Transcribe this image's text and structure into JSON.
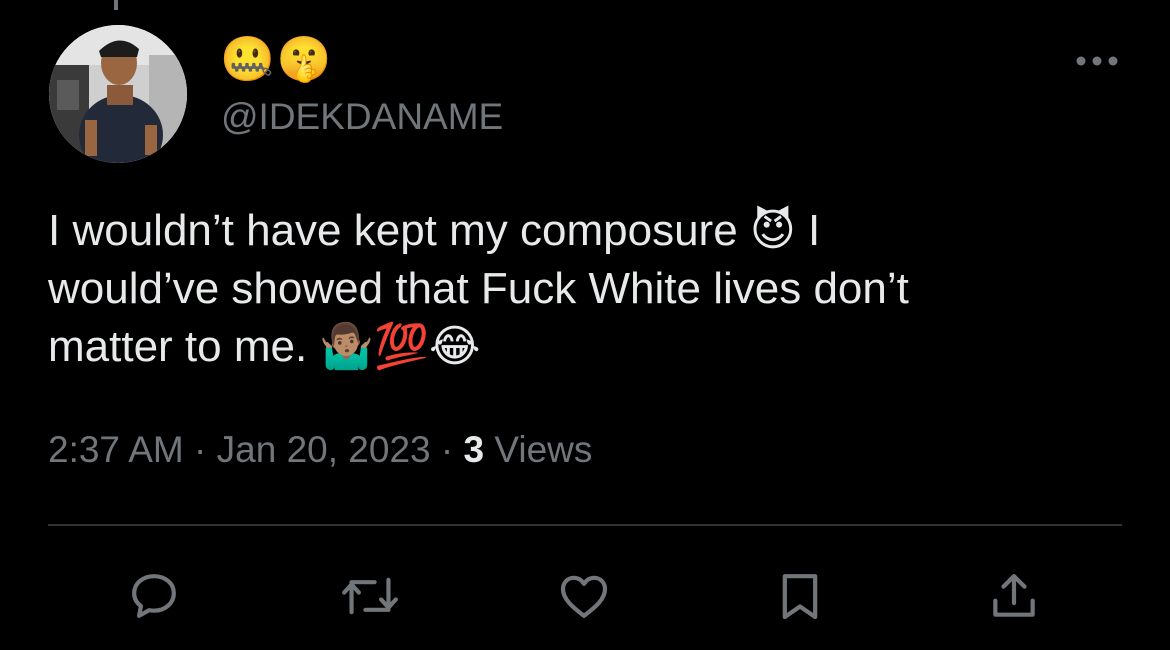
{
  "author": {
    "display_name": "🤐🤫",
    "handle": "@IDEKDANAME"
  },
  "tweet": {
    "text": "I wouldn’t have kept my composure 😈 I\nwould’ve showed that Fuck White lives don’t\nmatter to me. 🤷🏽‍♂️💯😂"
  },
  "meta": {
    "time": "2:37 AM",
    "separator": "·",
    "date": "Jan 20, 2023",
    "views_count": "3",
    "views_label": "Views"
  },
  "actions": [
    {
      "name": "reply",
      "icon": "speech-bubble-icon"
    },
    {
      "name": "retweet",
      "icon": "retweet-icon"
    },
    {
      "name": "like",
      "icon": "heart-icon"
    },
    {
      "name": "bookmark",
      "icon": "bookmark-icon"
    },
    {
      "name": "share",
      "icon": "share-icon"
    }
  ],
  "colors": {
    "background": "#000000",
    "primary_text": "#e7e9ea",
    "secondary_text": "#71767b",
    "divider": "#2f3336"
  }
}
